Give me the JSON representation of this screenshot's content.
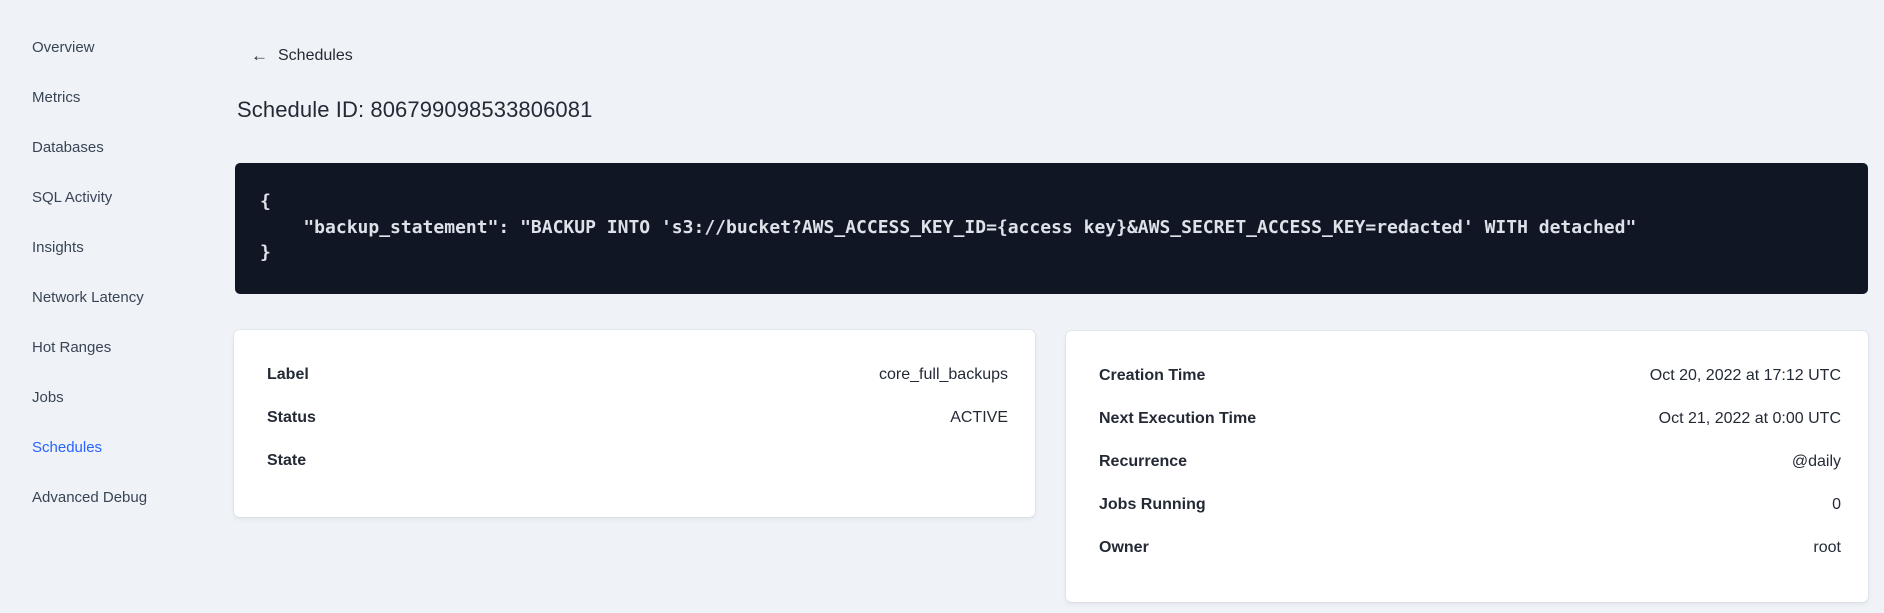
{
  "sidebar": {
    "items": [
      {
        "label": "Overview",
        "active": false
      },
      {
        "label": "Metrics",
        "active": false
      },
      {
        "label": "Databases",
        "active": false
      },
      {
        "label": "SQL Activity",
        "active": false
      },
      {
        "label": "Insights",
        "active": false
      },
      {
        "label": "Network Latency",
        "active": false
      },
      {
        "label": "Hot Ranges",
        "active": false
      },
      {
        "label": "Jobs",
        "active": false
      },
      {
        "label": "Schedules",
        "active": true
      },
      {
        "label": "Advanced Debug",
        "active": false
      }
    ]
  },
  "header": {
    "back_icon": "←",
    "back_label": "Schedules",
    "title": "Schedule ID: 806799098533806081"
  },
  "code_block": {
    "content": "{\n    \"backup_statement\": \"BACKUP INTO 's3://bucket?AWS_ACCESS_KEY_ID={access key}&AWS_SECRET_ACCESS_KEY=redacted' WITH detached\"\n}"
  },
  "label_card": {
    "rows": [
      {
        "label": "Label",
        "value": "core_full_backups"
      },
      {
        "label": "Status",
        "value": "ACTIVE"
      },
      {
        "label": "State",
        "value": ""
      }
    ]
  },
  "schedule_card": {
    "rows": [
      {
        "label": "Creation Time",
        "value": "Oct 20, 2022 at 17:12 UTC"
      },
      {
        "label": "Next Execution Time",
        "value": "Oct 21, 2022 at 0:00 UTC"
      },
      {
        "label": "Recurrence",
        "value": "@daily"
      },
      {
        "label": "Jobs Running",
        "value": "0"
      },
      {
        "label": "Owner",
        "value": "root"
      }
    ]
  },
  "colors": {
    "page_background": "#eff3f7",
    "active_link": "#2962ff",
    "nav_text": "#394455",
    "body_text": "#242a35",
    "code_background": "#101624",
    "code_text": "#dde1e8",
    "card_background": "#ffffff"
  }
}
